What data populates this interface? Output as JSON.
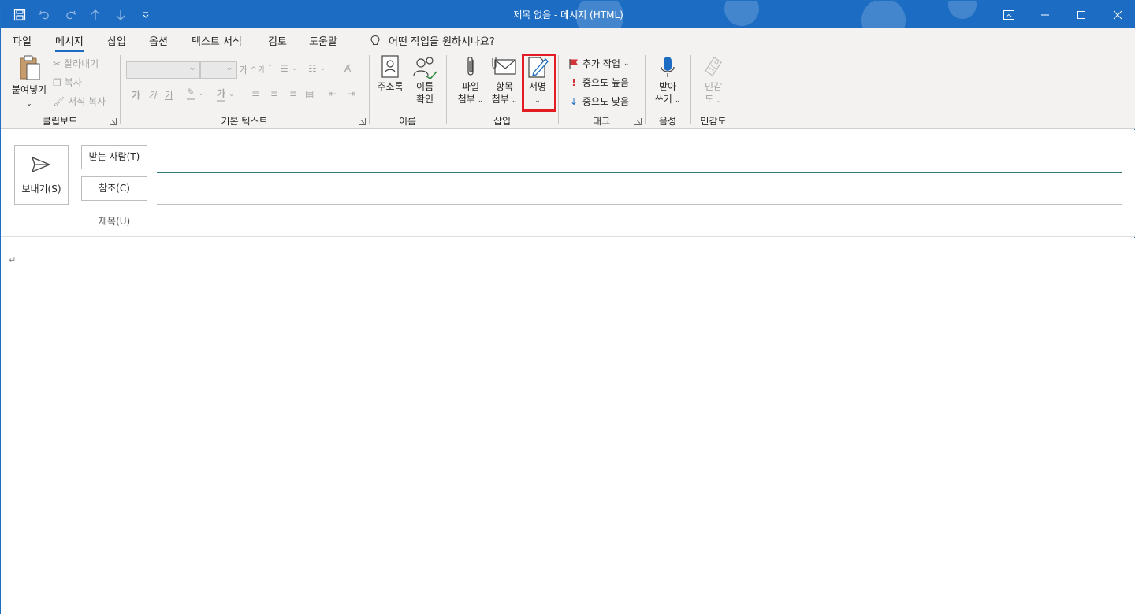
{
  "window": {
    "title": "제목 없음  -  메시지 (HTML)"
  },
  "qat": {
    "icons": [
      "save-icon",
      "undo-icon",
      "redo-icon",
      "up-arrow-icon",
      "down-arrow-icon",
      "customize-icon"
    ]
  },
  "tabs": [
    {
      "label": "파일"
    },
    {
      "label": "메시지"
    },
    {
      "label": "삽입"
    },
    {
      "label": "옵션"
    },
    {
      "label": "텍스트 서식"
    },
    {
      "label": "검토"
    },
    {
      "label": "도움말"
    }
  ],
  "tellme": {
    "placeholder": "어떤 작업을 원하시나요?"
  },
  "ribbon": {
    "clipboard": {
      "label": "클립보드",
      "paste": "붙여넣기",
      "cut": "잘라내기",
      "copy": "복사",
      "format_painter": "서식 복사"
    },
    "basic_text": {
      "label": "기본 텍스트",
      "grow_font": "가",
      "shrink_font": "가",
      "bold": "가",
      "italic": "가",
      "underline": "가"
    },
    "names": {
      "label": "이름",
      "address_book": "주소록",
      "check_names_line1": "이름",
      "check_names_line2": "확인"
    },
    "insert": {
      "label": "삽입",
      "attach_file_line1": "파일",
      "attach_file_line2": "첨부",
      "attach_item_line1": "항목",
      "attach_item_line2": "첨부",
      "signature": "서명"
    },
    "tags": {
      "label": "태그",
      "follow_up": "추가 작업",
      "high_importance": "중요도 높음",
      "low_importance": "중요도 낮음"
    },
    "voice": {
      "label": "음성",
      "dictate_line1": "받아",
      "dictate_line2": "쓰기"
    },
    "sensitivity": {
      "label": "민감도",
      "btn_line1": "민감",
      "btn_line2": "도"
    }
  },
  "compose": {
    "send": "보내기(S)",
    "to": "받는 사람(T)",
    "cc": "참조(C)",
    "subject": "제목(U)",
    "body_mark": "↵"
  }
}
